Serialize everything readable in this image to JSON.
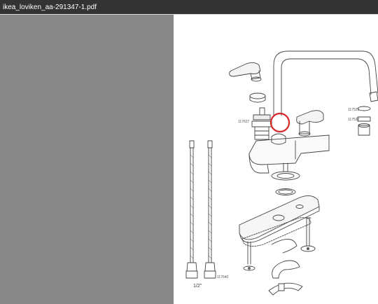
{
  "window": {
    "title": "ikea_loviken_aa-291347-1.pdf"
  },
  "diagram": {
    "part_numbers": [
      "117637",
      "117529",
      "117532",
      "117640"
    ],
    "pipe_size_label": "1/2\"",
    "highlight_color": "#d62828"
  }
}
